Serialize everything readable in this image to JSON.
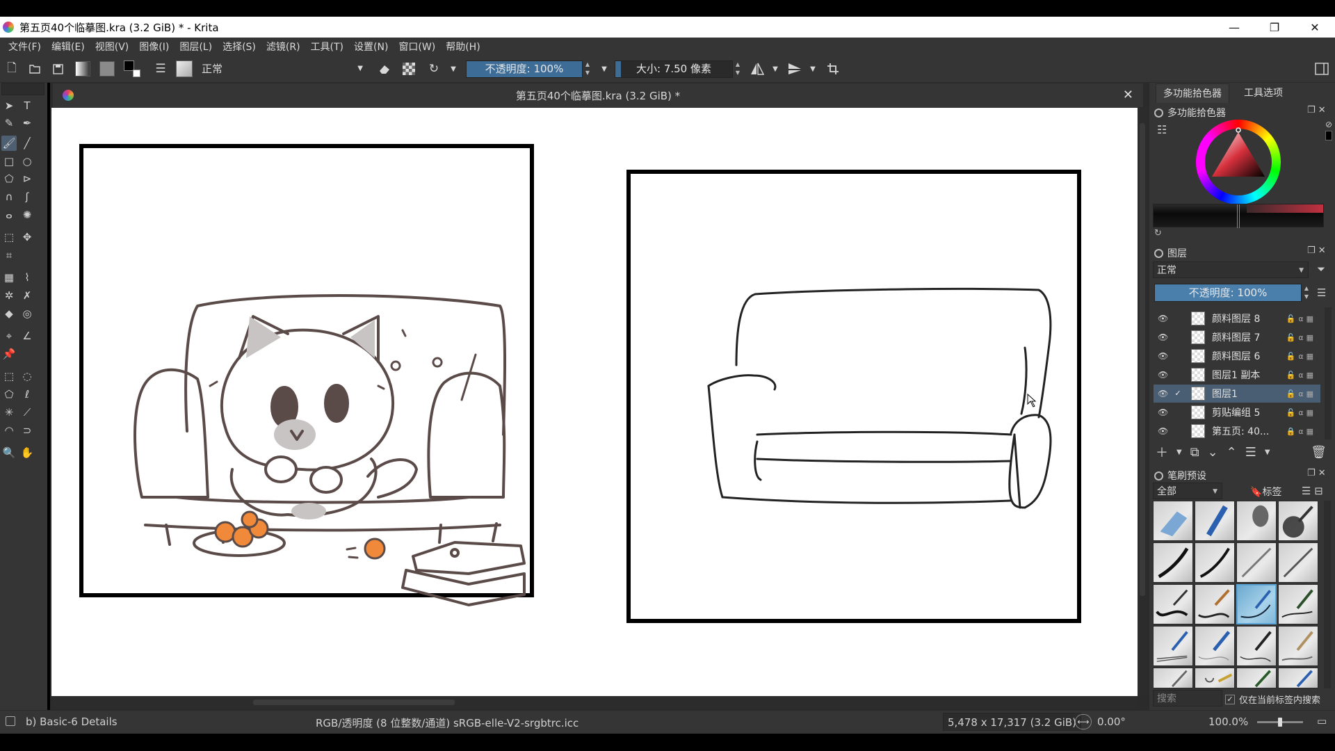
{
  "window": {
    "title": "第五页40个临摹图.kra (3.2 GiB) * - Krita",
    "minimize": "—",
    "restore": "❐",
    "close": "✕"
  },
  "menu": [
    "文件(F)",
    "编辑(E)",
    "视图(V)",
    "图像(I)",
    "图层(L)",
    "选择(S)",
    "滤镜(R)",
    "工具(T)",
    "设置(N)",
    "窗口(W)",
    "帮助(H)"
  ],
  "toolbar": {
    "blend_mode": "正常",
    "opacity_label": "不透明度:  100%",
    "opacity_value": 100,
    "size_label": "大小:  7.50 像素",
    "size_fraction": 0.05
  },
  "document": {
    "tab_title": "第五页40个临摹图.kra (3.2 GiB) *",
    "close": "✕"
  },
  "dockers": {
    "tabs": [
      "多功能拾色器",
      "工具选项"
    ],
    "color_selector_title": "多功能拾色器",
    "layers_title": "图层",
    "layers_blend": "正常",
    "layers_opacity": "不透明度:  100%",
    "layers": [
      {
        "name": "颜料图层 8",
        "visible": true,
        "selected": false,
        "locked": false
      },
      {
        "name": "颜料图层 7",
        "visible": true,
        "selected": false,
        "locked": false
      },
      {
        "name": "颜料图层 6",
        "visible": true,
        "selected": false,
        "locked": false
      },
      {
        "name": "图层1 副本",
        "visible": true,
        "selected": false,
        "locked": false
      },
      {
        "name": "图层1",
        "visible": true,
        "selected": true,
        "locked": false
      },
      {
        "name": "剪贴编组 5",
        "visible": true,
        "selected": false,
        "locked": false
      },
      {
        "name": "第五页: 40...",
        "visible": true,
        "selected": false,
        "locked": true
      }
    ],
    "brush_presets_title": "笔刷预设",
    "brush_filter": "全部",
    "brush_tag_label": "标签",
    "search_placeholder": "搜索",
    "search_in_tag_label": "仅在当前标签内搜索",
    "search_in_tag_checked": true
  },
  "status": {
    "brush_name": "b) Basic-6 Details",
    "color_space": "RGB/透明度 (8 位整数/通道)  sRGB-elle-V2-srgbtrc.icc",
    "image_size": "5,478 x 17,317 (3.2 GiB)",
    "rotation": "0.00°",
    "zoom": "100.0%"
  }
}
